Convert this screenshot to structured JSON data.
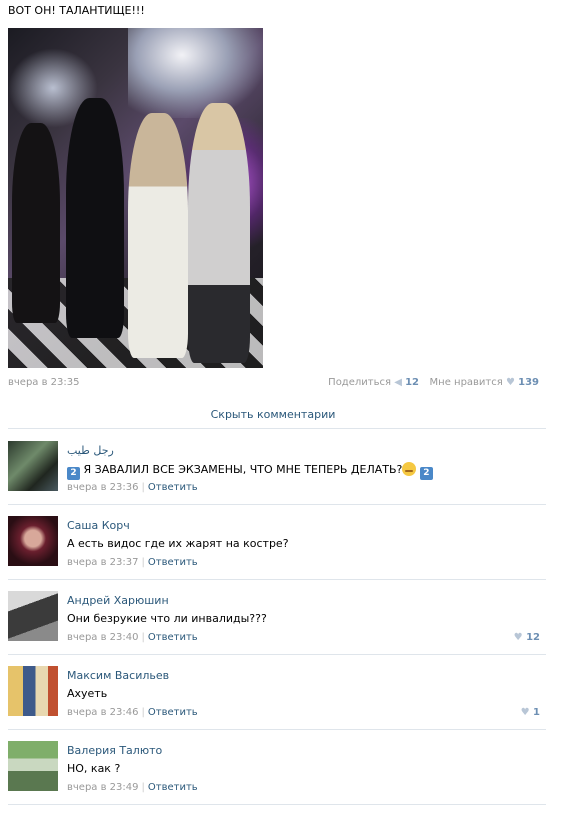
{
  "post": {
    "text": "ВОТ ОН! ТАЛАНТИЩЕ!!!",
    "date": "вчера в 23:35",
    "share_label": "Поделиться",
    "share_count": "12",
    "like_label": "Мне нравится",
    "like_count": "139"
  },
  "hide_comments_label": "Скрыть комментарии",
  "comments": [
    {
      "author": "رجل طيب",
      "text": "Я ЗАВАЛИЛ ВСЕ ЭКЗАМЕНЫ, ЧТО МНЕ ТЕПЕРЬ ДЕЛАТЬ?",
      "emoji_left": "2",
      "emoji_right": "2",
      "time": "вчера в 23:36",
      "reply": "Ответить",
      "likes": ""
    },
    {
      "author": "Саша Корч",
      "text": "А есть видос где их жарят на костре?",
      "time": "вчера в 23:37",
      "reply": "Ответить",
      "likes": ""
    },
    {
      "author": "Андрей Харюшин",
      "text": "Они безрукие что ли инвалиды???",
      "time": "вчера в 23:40",
      "reply": "Ответить",
      "likes": "12"
    },
    {
      "author": "Максим Васильев",
      "text": "Ахуеть",
      "time": "вчера в 23:46",
      "reply": "Ответить",
      "likes": "1"
    },
    {
      "author": "Валерия Талюто",
      "text": "НО, как ?",
      "time": "вчера в 23:49",
      "reply": "Ответить",
      "likes": ""
    }
  ],
  "colors": {
    "link": "#2b587a",
    "muted": "#999999",
    "count": "#6d8fb3",
    "divider": "#dfe5eb"
  }
}
